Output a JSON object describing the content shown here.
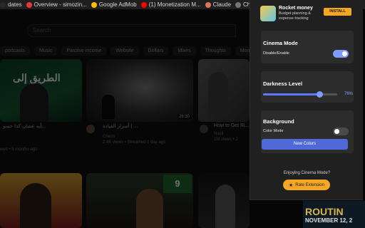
{
  "bookmarks": [
    {
      "label": "dates",
      "color": "#2a2a2a"
    },
    {
      "label": "Overview - simozin...",
      "color": "#e53935"
    },
    {
      "label": "Google AdMob",
      "color": "#fbbc04"
    },
    {
      "label": "(1) Monetization M...",
      "color": "#ff0000"
    },
    {
      "label": "Claude",
      "color": "#d97757"
    },
    {
      "label": "Cha",
      "color": "#777777"
    }
  ],
  "youtube": {
    "search_placeholder": "Search",
    "chips": [
      "podcasts",
      "Music",
      "Passive income",
      "Website",
      "Dollars",
      "Mixes",
      "Thoughts",
      "Monetization"
    ],
    "videos": [
      {
        "title": "أيه عشان كدا حسو...",
        "channel": "",
        "meta": "ews • 9 months ago",
        "thumb_text": "الطريق إلى",
        "time": ""
      },
      {
        "title": "أسرار القيادة | ...",
        "channel": "Chess",
        "meta": "2.4K views • Streamed 1 day ago",
        "time": "26:30",
        "extra": "2.4K views"
      },
      {
        "title": "How to Get Ri...",
        "channel": "Nazil",
        "meta": "1M views • 2",
        "time": ""
      }
    ],
    "thumb_time_2": "26:30",
    "corner_title": "ROUTIN",
    "corner_date": "NOVEMBER 12, 2"
  },
  "popup": {
    "ad": {
      "title": "Rocket money",
      "desc": "Budget planning & expense tracking",
      "install_label": "INSTALL"
    },
    "cinema": {
      "title": "Cinema Mode",
      "label": "Disable/Enable",
      "enabled": true
    },
    "darkness": {
      "title": "Darkness Level",
      "value_label": "76%",
      "value": 0.76
    },
    "background": {
      "title": "Background",
      "label": "Color Mode",
      "enabled": false,
      "button_label": "New Colors"
    },
    "footer": {
      "enjoy_text": "Enjoying Cinema Mode?",
      "rate_label": "Rate Extension",
      "rate_icon": "star-icon"
    },
    "colors": {
      "accent": "#5b7bff",
      "accent_light": "#7f9bff",
      "button_bg": "#4f69d6",
      "rate_bg": "#f5a623",
      "install_bg": "#f5a623"
    }
  }
}
